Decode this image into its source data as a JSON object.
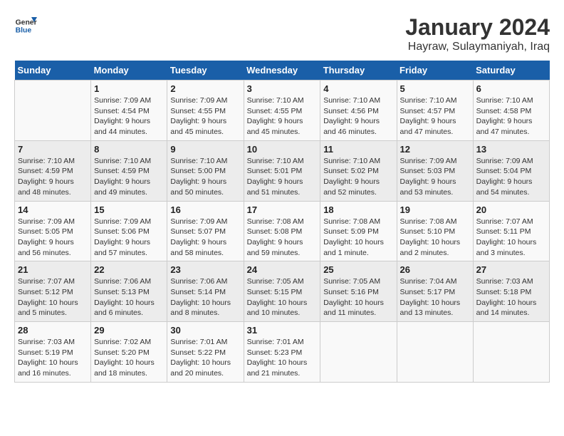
{
  "logo": {
    "line1": "General",
    "line2": "Blue"
  },
  "title": "January 2024",
  "subtitle": "Hayraw, Sulaymaniyah, Iraq",
  "header": {
    "days": [
      "Sunday",
      "Monday",
      "Tuesday",
      "Wednesday",
      "Thursday",
      "Friday",
      "Saturday"
    ]
  },
  "weeks": [
    [
      {
        "day": "",
        "sunrise": "",
        "sunset": "",
        "daylight": ""
      },
      {
        "day": "1",
        "sunrise": "Sunrise: 7:09 AM",
        "sunset": "Sunset: 4:54 PM",
        "daylight": "Daylight: 9 hours and 44 minutes."
      },
      {
        "day": "2",
        "sunrise": "Sunrise: 7:09 AM",
        "sunset": "Sunset: 4:55 PM",
        "daylight": "Daylight: 9 hours and 45 minutes."
      },
      {
        "day": "3",
        "sunrise": "Sunrise: 7:10 AM",
        "sunset": "Sunset: 4:55 PM",
        "daylight": "Daylight: 9 hours and 45 minutes."
      },
      {
        "day": "4",
        "sunrise": "Sunrise: 7:10 AM",
        "sunset": "Sunset: 4:56 PM",
        "daylight": "Daylight: 9 hours and 46 minutes."
      },
      {
        "day": "5",
        "sunrise": "Sunrise: 7:10 AM",
        "sunset": "Sunset: 4:57 PM",
        "daylight": "Daylight: 9 hours and 47 minutes."
      },
      {
        "day": "6",
        "sunrise": "Sunrise: 7:10 AM",
        "sunset": "Sunset: 4:58 PM",
        "daylight": "Daylight: 9 hours and 47 minutes."
      }
    ],
    [
      {
        "day": "7",
        "sunrise": "Sunrise: 7:10 AM",
        "sunset": "Sunset: 4:59 PM",
        "daylight": "Daylight: 9 hours and 48 minutes."
      },
      {
        "day": "8",
        "sunrise": "Sunrise: 7:10 AM",
        "sunset": "Sunset: 4:59 PM",
        "daylight": "Daylight: 9 hours and 49 minutes."
      },
      {
        "day": "9",
        "sunrise": "Sunrise: 7:10 AM",
        "sunset": "Sunset: 5:00 PM",
        "daylight": "Daylight: 9 hours and 50 minutes."
      },
      {
        "day": "10",
        "sunrise": "Sunrise: 7:10 AM",
        "sunset": "Sunset: 5:01 PM",
        "daylight": "Daylight: 9 hours and 51 minutes."
      },
      {
        "day": "11",
        "sunrise": "Sunrise: 7:10 AM",
        "sunset": "Sunset: 5:02 PM",
        "daylight": "Daylight: 9 hours and 52 minutes."
      },
      {
        "day": "12",
        "sunrise": "Sunrise: 7:09 AM",
        "sunset": "Sunset: 5:03 PM",
        "daylight": "Daylight: 9 hours and 53 minutes."
      },
      {
        "day": "13",
        "sunrise": "Sunrise: 7:09 AM",
        "sunset": "Sunset: 5:04 PM",
        "daylight": "Daylight: 9 hours and 54 minutes."
      }
    ],
    [
      {
        "day": "14",
        "sunrise": "Sunrise: 7:09 AM",
        "sunset": "Sunset: 5:05 PM",
        "daylight": "Daylight: 9 hours and 56 minutes."
      },
      {
        "day": "15",
        "sunrise": "Sunrise: 7:09 AM",
        "sunset": "Sunset: 5:06 PM",
        "daylight": "Daylight: 9 hours and 57 minutes."
      },
      {
        "day": "16",
        "sunrise": "Sunrise: 7:09 AM",
        "sunset": "Sunset: 5:07 PM",
        "daylight": "Daylight: 9 hours and 58 minutes."
      },
      {
        "day": "17",
        "sunrise": "Sunrise: 7:08 AM",
        "sunset": "Sunset: 5:08 PM",
        "daylight": "Daylight: 9 hours and 59 minutes."
      },
      {
        "day": "18",
        "sunrise": "Sunrise: 7:08 AM",
        "sunset": "Sunset: 5:09 PM",
        "daylight": "Daylight: 10 hours and 1 minute."
      },
      {
        "day": "19",
        "sunrise": "Sunrise: 7:08 AM",
        "sunset": "Sunset: 5:10 PM",
        "daylight": "Daylight: 10 hours and 2 minutes."
      },
      {
        "day": "20",
        "sunrise": "Sunrise: 7:07 AM",
        "sunset": "Sunset: 5:11 PM",
        "daylight": "Daylight: 10 hours and 3 minutes."
      }
    ],
    [
      {
        "day": "21",
        "sunrise": "Sunrise: 7:07 AM",
        "sunset": "Sunset: 5:12 PM",
        "daylight": "Daylight: 10 hours and 5 minutes."
      },
      {
        "day": "22",
        "sunrise": "Sunrise: 7:06 AM",
        "sunset": "Sunset: 5:13 PM",
        "daylight": "Daylight: 10 hours and 6 minutes."
      },
      {
        "day": "23",
        "sunrise": "Sunrise: 7:06 AM",
        "sunset": "Sunset: 5:14 PM",
        "daylight": "Daylight: 10 hours and 8 minutes."
      },
      {
        "day": "24",
        "sunrise": "Sunrise: 7:05 AM",
        "sunset": "Sunset: 5:15 PM",
        "daylight": "Daylight: 10 hours and 10 minutes."
      },
      {
        "day": "25",
        "sunrise": "Sunrise: 7:05 AM",
        "sunset": "Sunset: 5:16 PM",
        "daylight": "Daylight: 10 hours and 11 minutes."
      },
      {
        "day": "26",
        "sunrise": "Sunrise: 7:04 AM",
        "sunset": "Sunset: 5:17 PM",
        "daylight": "Daylight: 10 hours and 13 minutes."
      },
      {
        "day": "27",
        "sunrise": "Sunrise: 7:03 AM",
        "sunset": "Sunset: 5:18 PM",
        "daylight": "Daylight: 10 hours and 14 minutes."
      }
    ],
    [
      {
        "day": "28",
        "sunrise": "Sunrise: 7:03 AM",
        "sunset": "Sunset: 5:19 PM",
        "daylight": "Daylight: 10 hours and 16 minutes."
      },
      {
        "day": "29",
        "sunrise": "Sunrise: 7:02 AM",
        "sunset": "Sunset: 5:20 PM",
        "daylight": "Daylight: 10 hours and 18 minutes."
      },
      {
        "day": "30",
        "sunrise": "Sunrise: 7:01 AM",
        "sunset": "Sunset: 5:22 PM",
        "daylight": "Daylight: 10 hours and 20 minutes."
      },
      {
        "day": "31",
        "sunrise": "Sunrise: 7:01 AM",
        "sunset": "Sunset: 5:23 PM",
        "daylight": "Daylight: 10 hours and 21 minutes."
      },
      {
        "day": "",
        "sunrise": "",
        "sunset": "",
        "daylight": ""
      },
      {
        "day": "",
        "sunrise": "",
        "sunset": "",
        "daylight": ""
      },
      {
        "day": "",
        "sunrise": "",
        "sunset": "",
        "daylight": ""
      }
    ]
  ]
}
